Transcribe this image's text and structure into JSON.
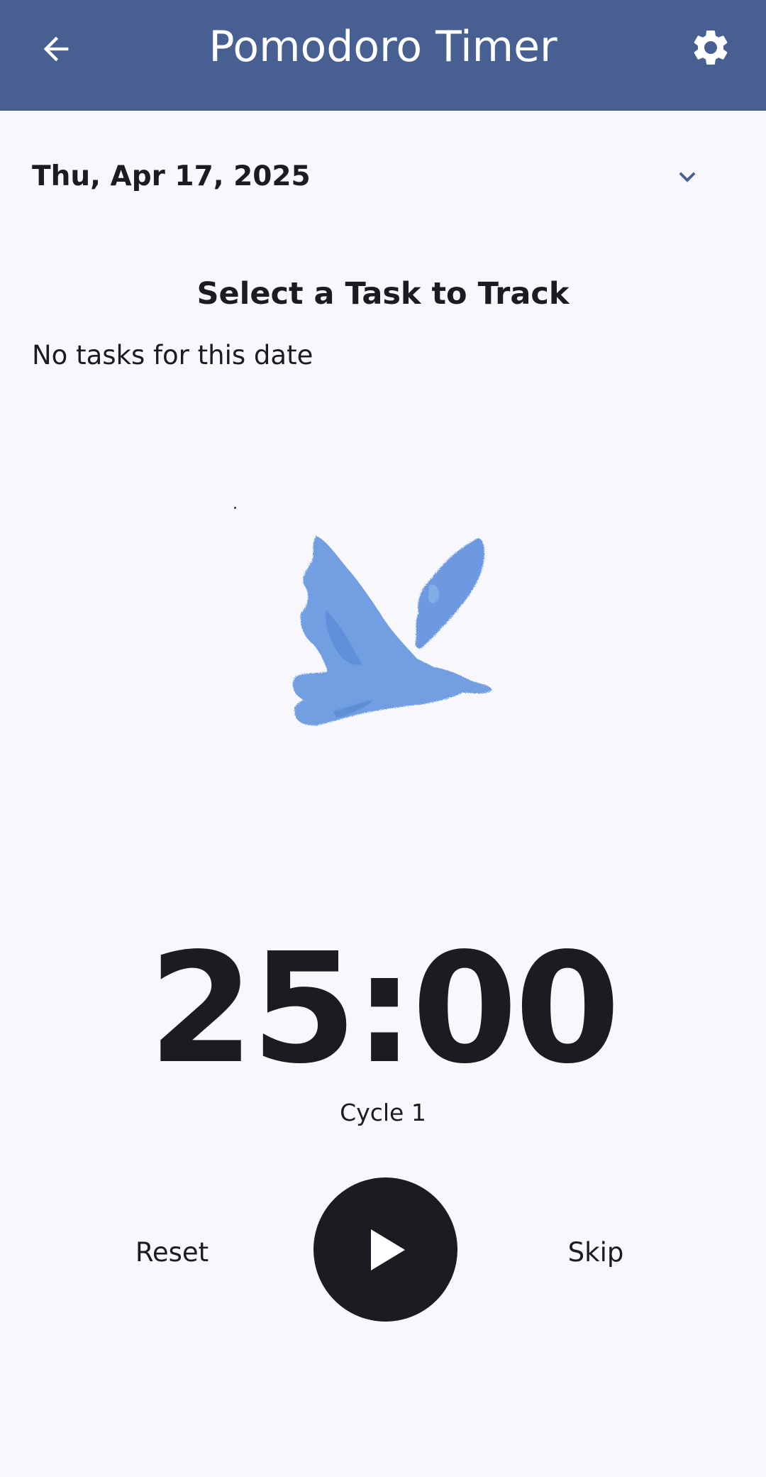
{
  "app_bar": {
    "title": "Pomodoro Timer",
    "back_icon": "arrow-back-icon",
    "settings_icon": "gear-icon",
    "background_color": "#475f91"
  },
  "date_selector": {
    "value": "Thu, Apr 17, 2025",
    "icon": "chevron-down-icon"
  },
  "task_section": {
    "title": "Select a Task to Track",
    "empty_message": "No tasks for this date"
  },
  "illustration": {
    "icon": "bird-illustration",
    "color": "#5b8fd9"
  },
  "timer": {
    "time": "25:00",
    "cycle_label": "Cycle 1"
  },
  "controls": {
    "reset_label": "Reset",
    "skip_label": "Skip",
    "play_icon": "play-icon"
  }
}
